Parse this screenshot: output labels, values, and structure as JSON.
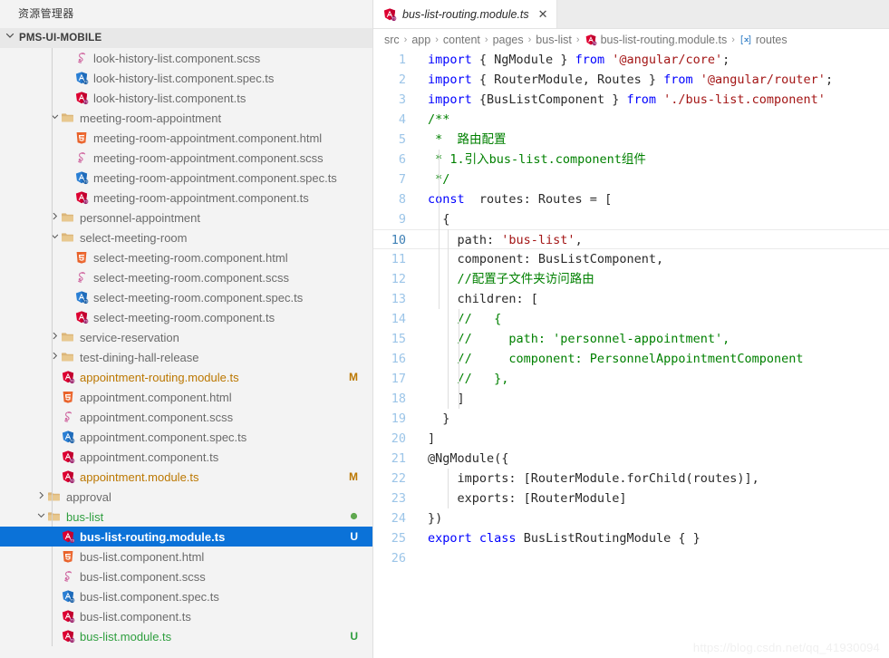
{
  "sidebar": {
    "explorer_title": "资源管理器",
    "root_folder": "PMS-UI-MOBILE",
    "root_chevron": "chevron-down",
    "tree": [
      {
        "label": "look-history-list.component.scss",
        "icon": "scss",
        "indent": 5,
        "twisty": "",
        "badge": "",
        "state": "normal"
      },
      {
        "label": "look-history-list.component.spec.ts",
        "icon": "spec",
        "indent": 5,
        "twisty": "",
        "badge": "",
        "state": "normal"
      },
      {
        "label": "look-history-list.component.ts",
        "icon": "ng",
        "indent": 5,
        "twisty": "",
        "badge": "",
        "state": "normal"
      },
      {
        "label": "meeting-room-appointment",
        "icon": "folder",
        "indent": 4,
        "twisty": "down",
        "badge": "",
        "state": "normal"
      },
      {
        "label": "meeting-room-appointment.component.html",
        "icon": "html",
        "indent": 5,
        "twisty": "",
        "badge": "",
        "state": "normal"
      },
      {
        "label": "meeting-room-appointment.component.scss",
        "icon": "scss",
        "indent": 5,
        "twisty": "",
        "badge": "",
        "state": "normal"
      },
      {
        "label": "meeting-room-appointment.component.spec.ts",
        "icon": "spec",
        "indent": 5,
        "twisty": "",
        "badge": "",
        "state": "normal"
      },
      {
        "label": "meeting-room-appointment.component.ts",
        "icon": "ng",
        "indent": 5,
        "twisty": "",
        "badge": "",
        "state": "normal"
      },
      {
        "label": "personnel-appointment",
        "icon": "folder",
        "indent": 4,
        "twisty": "right",
        "badge": "",
        "state": "normal"
      },
      {
        "label": "select-meeting-room",
        "icon": "folder",
        "indent": 4,
        "twisty": "down",
        "badge": "",
        "state": "normal"
      },
      {
        "label": "select-meeting-room.component.html",
        "icon": "html",
        "indent": 5,
        "twisty": "",
        "badge": "",
        "state": "normal"
      },
      {
        "label": "select-meeting-room.component.scss",
        "icon": "scss",
        "indent": 5,
        "twisty": "",
        "badge": "",
        "state": "normal"
      },
      {
        "label": "select-meeting-room.component.spec.ts",
        "icon": "spec",
        "indent": 5,
        "twisty": "",
        "badge": "",
        "state": "normal"
      },
      {
        "label": "select-meeting-room.component.ts",
        "icon": "ng",
        "indent": 5,
        "twisty": "",
        "badge": "",
        "state": "normal"
      },
      {
        "label": "service-reservation",
        "icon": "folder",
        "indent": 4,
        "twisty": "right",
        "badge": "",
        "state": "normal"
      },
      {
        "label": "test-dining-hall-release",
        "icon": "folder",
        "indent": 4,
        "twisty": "right",
        "badge": "",
        "state": "normal"
      },
      {
        "label": "appointment-routing.module.ts",
        "icon": "ng",
        "indent": 4,
        "twisty": "",
        "badge": "M",
        "state": "modified"
      },
      {
        "label": "appointment.component.html",
        "icon": "html",
        "indent": 4,
        "twisty": "",
        "badge": "",
        "state": "normal"
      },
      {
        "label": "appointment.component.scss",
        "icon": "scss",
        "indent": 4,
        "twisty": "",
        "badge": "",
        "state": "normal"
      },
      {
        "label": "appointment.component.spec.ts",
        "icon": "spec",
        "indent": 4,
        "twisty": "",
        "badge": "",
        "state": "normal"
      },
      {
        "label": "appointment.component.ts",
        "icon": "ng",
        "indent": 4,
        "twisty": "",
        "badge": "",
        "state": "normal"
      },
      {
        "label": "appointment.module.ts",
        "icon": "ng",
        "indent": 4,
        "twisty": "",
        "badge": "M",
        "state": "modified"
      },
      {
        "label": "approval",
        "icon": "folder",
        "indent": 3,
        "twisty": "right",
        "badge": "",
        "state": "normal"
      },
      {
        "label": "bus-list",
        "icon": "folder",
        "indent": 3,
        "twisty": "down",
        "badge": "dot",
        "state": "untracked"
      },
      {
        "label": "bus-list-routing.module.ts",
        "icon": "ng",
        "indent": 4,
        "twisty": "",
        "badge": "U",
        "state": "selected"
      },
      {
        "label": "bus-list.component.html",
        "icon": "html",
        "indent": 4,
        "twisty": "",
        "badge": "",
        "state": "normal"
      },
      {
        "label": "bus-list.component.scss",
        "icon": "scss",
        "indent": 4,
        "twisty": "",
        "badge": "",
        "state": "normal"
      },
      {
        "label": "bus-list.component.spec.ts",
        "icon": "spec",
        "indent": 4,
        "twisty": "",
        "badge": "",
        "state": "normal"
      },
      {
        "label": "bus-list.component.ts",
        "icon": "ng",
        "indent": 4,
        "twisty": "",
        "badge": "",
        "state": "normal"
      },
      {
        "label": "bus-list.module.ts",
        "icon": "ng",
        "indent": 4,
        "twisty": "",
        "badge": "U",
        "state": "untracked"
      }
    ]
  },
  "editor": {
    "tab": {
      "icon": "ng",
      "label": "bus-list-routing.module.ts",
      "close_glyph": "✕"
    },
    "breadcrumb": [
      {
        "label": "src",
        "icon": ""
      },
      {
        "label": "app",
        "icon": ""
      },
      {
        "label": "content",
        "icon": ""
      },
      {
        "label": "pages",
        "icon": ""
      },
      {
        "label": "bus-list",
        "icon": ""
      },
      {
        "label": "bus-list-routing.module.ts",
        "icon": "ng"
      },
      {
        "label": "routes",
        "icon": "symbol-variable"
      }
    ],
    "breadcrumb_separator": "›",
    "active_line": 10,
    "lines": [
      {
        "n": 1,
        "tokens": [
          {
            "t": "import",
            "c": "k"
          },
          {
            "t": " { NgModule } ",
            "c": "pl"
          },
          {
            "t": "from",
            "c": "k"
          },
          {
            "t": " ",
            "c": "pl"
          },
          {
            "t": "'@angular/core'",
            "c": "s"
          },
          {
            "t": ";",
            "c": "pl"
          }
        ]
      },
      {
        "n": 2,
        "tokens": [
          {
            "t": "import",
            "c": "k"
          },
          {
            "t": " { RouterModule, Routes } ",
            "c": "pl"
          },
          {
            "t": "from",
            "c": "k"
          },
          {
            "t": " ",
            "c": "pl"
          },
          {
            "t": "'@angular/router'",
            "c": "s"
          },
          {
            "t": ";",
            "c": "pl"
          }
        ]
      },
      {
        "n": 3,
        "tokens": [
          {
            "t": "import",
            "c": "k"
          },
          {
            "t": " {BusListComponent } ",
            "c": "pl"
          },
          {
            "t": "from",
            "c": "k"
          },
          {
            "t": " ",
            "c": "pl"
          },
          {
            "t": "'./bus-list.component'",
            "c": "s"
          }
        ]
      },
      {
        "n": 4,
        "tokens": [
          {
            "t": "/**",
            "c": "cm"
          }
        ]
      },
      {
        "n": 5,
        "tokens": [
          {
            "t": " *  路由配置",
            "c": "cm"
          }
        ]
      },
      {
        "n": 6,
        "tokens": [
          {
            "t": " * 1.引入bus-list.component组件",
            "c": "cm"
          }
        ]
      },
      {
        "n": 7,
        "tokens": [
          {
            "t": " */",
            "c": "cm"
          }
        ]
      },
      {
        "n": 8,
        "tokens": [
          {
            "t": "const",
            "c": "k"
          },
          {
            "t": "  routes: Routes = [",
            "c": "pl"
          }
        ]
      },
      {
        "n": 9,
        "tokens": [
          {
            "t": "  {",
            "c": "pl"
          }
        ]
      },
      {
        "n": 10,
        "tokens": [
          {
            "t": "    path: ",
            "c": "pl"
          },
          {
            "t": "'bus-list'",
            "c": "s"
          },
          {
            "t": ",",
            "c": "pl"
          }
        ]
      },
      {
        "n": 11,
        "tokens": [
          {
            "t": "    component: BusListComponent,",
            "c": "pl"
          }
        ]
      },
      {
        "n": 12,
        "tokens": [
          {
            "t": "    //配置子文件夹访问路由",
            "c": "cm"
          }
        ]
      },
      {
        "n": 13,
        "tokens": [
          {
            "t": "    children: [",
            "c": "pl"
          }
        ]
      },
      {
        "n": 14,
        "tokens": [
          {
            "t": "    //   {",
            "c": "cm"
          }
        ]
      },
      {
        "n": 15,
        "tokens": [
          {
            "t": "    //     path: 'personnel-appointment',",
            "c": "cm"
          }
        ]
      },
      {
        "n": 16,
        "tokens": [
          {
            "t": "    //     component: PersonnelAppointmentComponent",
            "c": "cm"
          }
        ]
      },
      {
        "n": 17,
        "tokens": [
          {
            "t": "    //   },",
            "c": "cm"
          }
        ]
      },
      {
        "n": 18,
        "tokens": [
          {
            "t": "    ]",
            "c": "pl"
          }
        ]
      },
      {
        "n": 19,
        "tokens": [
          {
            "t": "  }",
            "c": "pl"
          }
        ]
      },
      {
        "n": 20,
        "tokens": [
          {
            "t": "]",
            "c": "pl"
          }
        ]
      },
      {
        "n": 21,
        "tokens": [
          {
            "t": "@NgModule({",
            "c": "pl"
          }
        ]
      },
      {
        "n": 22,
        "tokens": [
          {
            "t": "    imports: [RouterModule.forChild(routes)],",
            "c": "pl"
          }
        ]
      },
      {
        "n": 23,
        "tokens": [
          {
            "t": "    exports: [RouterModule]",
            "c": "pl"
          }
        ]
      },
      {
        "n": 24,
        "tokens": [
          {
            "t": "})",
            "c": "pl"
          }
        ]
      },
      {
        "n": 25,
        "tokens": [
          {
            "t": "export",
            "c": "k"
          },
          {
            "t": " ",
            "c": "pl"
          },
          {
            "t": "class",
            "c": "k"
          },
          {
            "t": " BusListRoutingModule { }",
            "c": "pl"
          }
        ]
      },
      {
        "n": 26,
        "tokens": [
          {
            "t": "",
            "c": "pl"
          }
        ]
      }
    ]
  },
  "watermark": "https://blog.csdn.net/qq_41930094",
  "colors": {
    "selection_blue": "#0b72d8",
    "modified_orange": "#bb7700",
    "untracked_green": "#2e9e3e",
    "sidebar_bg": "#f3f3f3",
    "keyword_blue": "#0000ff",
    "string_red": "#a31515",
    "comment_green": "#008000",
    "cursor_red": "#ee2222"
  }
}
